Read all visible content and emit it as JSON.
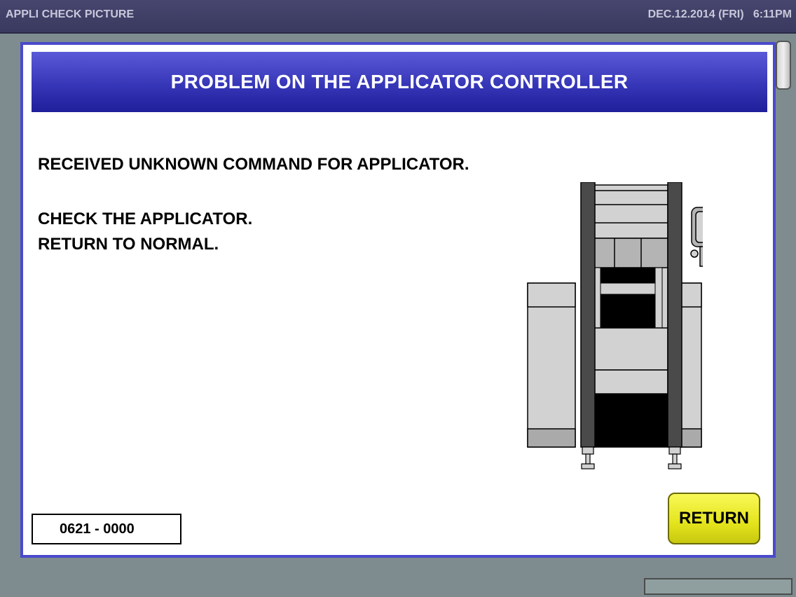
{
  "titlebar": {
    "title": "APPLI CHECK PICTURE",
    "datetime": "DEC.12.2014 (FRI)   6:11PM"
  },
  "dialog": {
    "header": "PROBLEM ON THE APPLICATOR CONTROLLER",
    "messages": [
      "RECEIVED UNKNOWN COMMAND FOR APPLICATOR.",
      "CHECK THE APPLICATOR.",
      "RETURN TO NORMAL."
    ],
    "error_code": "0621 - 0000",
    "return_label": "RETURN"
  },
  "colors": {
    "header_blue": "#3636b8",
    "dialog_border": "#4a4acb",
    "button_yellow": "#e4e41c",
    "background": "#7e8c8f"
  },
  "icons": {
    "machine_illustration": "applicator-machine-icon"
  }
}
